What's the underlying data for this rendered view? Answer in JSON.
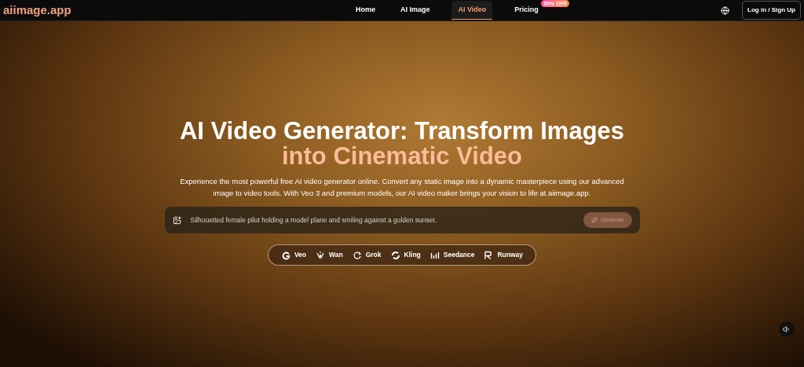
{
  "header": {
    "logo": "aiimage.app",
    "nav": [
      {
        "label": "Home",
        "selected": false
      },
      {
        "label": "AI Image",
        "selected": false
      },
      {
        "label": "AI Video",
        "selected": true
      },
      {
        "label": "Pricing",
        "selected": false,
        "badge": "50% OFF"
      }
    ],
    "login": "Log in / Sign Up"
  },
  "hero": {
    "title_line1": "AI Video Generator: Transform Images",
    "title_line2": "into Cinematic Video",
    "description": "Experience the most powerful free AI video generator online. Convert any static image into a dynamic masterpiece using our advanced image to video tools. With Veo 3 and premium models, our AI video maker brings your vision to life at aiimage.app.",
    "prompt": {
      "value": "Silhouetted female pilot holding a model plane and smiling against a golden sunset.",
      "generate": "Generate",
      "generate_disabled": true
    },
    "models": [
      {
        "kind": "g",
        "label": "Veo"
      },
      {
        "kind": "wan",
        "label": "Wan"
      },
      {
        "kind": "grok",
        "label": "Grok"
      },
      {
        "kind": "kling",
        "label": "Kling"
      },
      {
        "kind": "bars",
        "label": "Seedance"
      },
      {
        "kind": "r",
        "label": "Runway"
      }
    ]
  }
}
